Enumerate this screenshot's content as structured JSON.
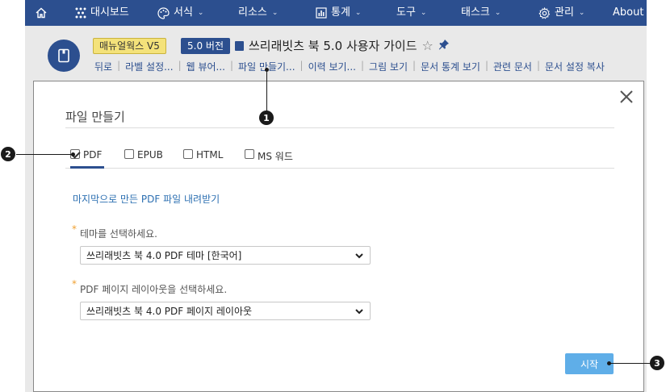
{
  "nav": {
    "home_icon": "home-icon",
    "items": [
      {
        "label": "대시보드",
        "icon": "dashboard-icon"
      },
      {
        "label": "서식",
        "icon": "palette-icon"
      },
      {
        "label": "리소스"
      },
      {
        "label": "통계",
        "icon": "chart-icon"
      },
      {
        "label": "도구"
      },
      {
        "label": "태스크"
      },
      {
        "label": "관리",
        "icon": "gear-icon"
      },
      {
        "label": "About"
      }
    ]
  },
  "doc": {
    "product_badge": "매뉴얼웍스 V5",
    "version_badge": "5.0 버전",
    "title": "쓰리래빗츠 북 5.0 사용자 가이드",
    "actions": [
      "뒤로",
      "라벨 설정...",
      "웹 뷰어...",
      "파일 만들기...",
      "이력 보기...",
      "그림 보기",
      "문서 통계 보기",
      "관련 문서",
      "문서 설정 복사"
    ]
  },
  "modal": {
    "title": "파일 만들기",
    "tabs": [
      {
        "label": "PDF",
        "checked": true
      },
      {
        "label": "EPUB",
        "checked": false
      },
      {
        "label": "HTML",
        "checked": false
      },
      {
        "label": "MS 워드",
        "checked": false
      }
    ],
    "last_pdf_link": "마지막으로 만든 PDF 파일 내려받기",
    "theme_label": "테마를 선택하세요.",
    "theme_value": "쓰리래빗츠 북 4.0 PDF 테마 [한국어]",
    "layout_label": "PDF 페이지 레이아웃을 선택하세요.",
    "layout_value": "쓰리래빗츠 북 4.0 PDF 페이지 레이아웃",
    "start_label": "시작",
    "required_mark": "*"
  },
  "callouts": {
    "c1": "1",
    "c2": "2",
    "c3": "3"
  },
  "colors": {
    "nav_bg": "#2c4f8f",
    "accent": "#2c4f8f",
    "start_button": "#5faee8",
    "link": "#2c6fb1",
    "required": "#f0a030"
  }
}
